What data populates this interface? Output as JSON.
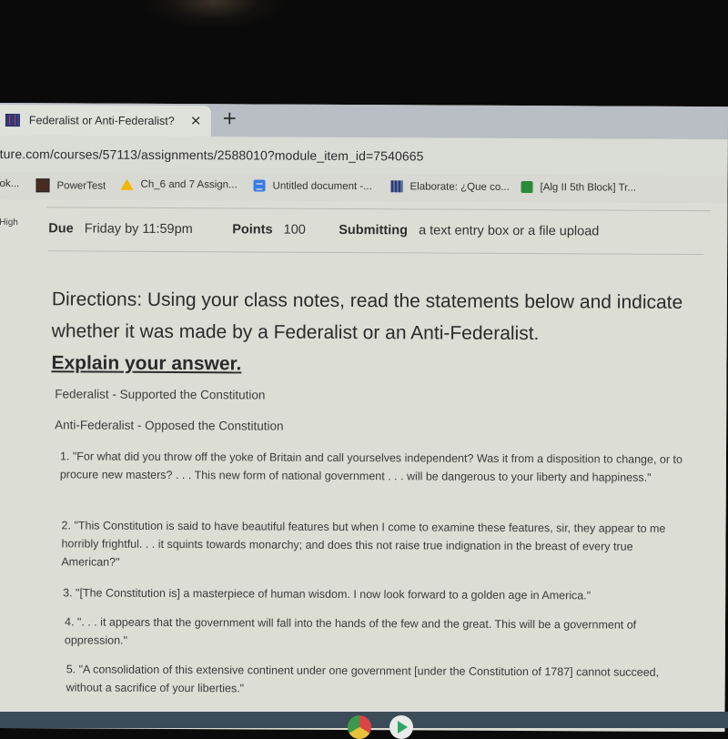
{
  "browser": {
    "tab": {
      "title": "Federalist or Anti-Federalist?",
      "close": "×",
      "new_tab": "+"
    },
    "url": "ture.com/courses/57113/assignments/2588010?module_item_id=7540665",
    "bookmarks": [
      {
        "label": "ok...",
        "icon": "truncated"
      },
      {
        "label": "PowerTest",
        "icon": "powertest-icon"
      },
      {
        "label": "Ch_6 and 7 Assign...",
        "icon": "google-drive-icon"
      },
      {
        "label": "Untitled document -...",
        "icon": "google-docs-icon"
      },
      {
        "label": "Elaborate: ¿Que co...",
        "icon": "site-icon"
      },
      {
        "label": "[Alg II 5th Block] Tr...",
        "icon": "google-classroom-icon"
      }
    ]
  },
  "assignment": {
    "side_label": "High",
    "due_label": "Due",
    "due_value": "Friday by 11:59pm",
    "points_label": "Points",
    "points_value": "100",
    "submitting_label": "Submitting",
    "submitting_value": "a text entry box or a file upload",
    "directions": "Directions: Using your class notes, read the statements  below and indicate whether it was made by a Federalist or an Anti-Federalist.",
    "explain": "Explain your answer.",
    "definitions": [
      "Federalist - Supported the Constitution",
      "Anti-Federalist - Opposed the Constitution"
    ],
    "statements": [
      "1. \"For what did you throw off the yoke of Britain and call yourselves independent? Was it from a disposition to change, or to procure new masters? . . . This new form of national government . . . will be dangerous to your liberty and happiness.\"",
      "2. \"This Constitution is said to have beautiful features but when I come to examine these features, sir, they appear to me horribly frightful. . . it squints towards monarchy; and does this not raise true indignation in the breast of every true American?\"",
      "3.  \"[The Constitution is] a masterpiece of human wisdom. I now look forward to a golden age in America.\"",
      "4.  \". . . it appears that the government will fall into the hands of the few and the great. This will be a government of oppression.\"",
      "5.  \"A consolidation of this extensive continent under one government [under the Constitution of 1787] cannot succeed, without a sacrifice of your liberties.\""
    ]
  },
  "taskbar": {
    "apps": [
      "chrome-icon",
      "play-store-icon"
    ]
  }
}
